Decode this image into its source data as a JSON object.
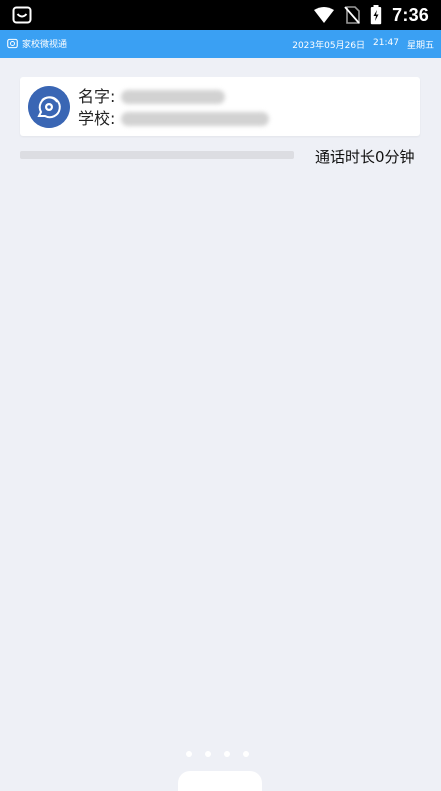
{
  "status_bar": {
    "time": "7:36",
    "icons": [
      "notification-icon",
      "wifi-icon",
      "no-sim-icon",
      "battery-charging-icon"
    ]
  },
  "app_bar": {
    "app_name": "家校微视通",
    "date": "2023年05月26日",
    "time": "21:47",
    "weekday": "星期五",
    "icon": "clock-icon"
  },
  "contact": {
    "name_label": "名字:",
    "school_label": "学校:",
    "avatar_icon": "video-call-icon"
  },
  "call": {
    "duration_text": "通话时长0分钟",
    "progress_fraction": 0
  },
  "pager": {
    "count": 4
  },
  "colors": {
    "app_bar": "#3aa0f3",
    "background": "#eef0f6",
    "avatar": "#3a66b4"
  }
}
